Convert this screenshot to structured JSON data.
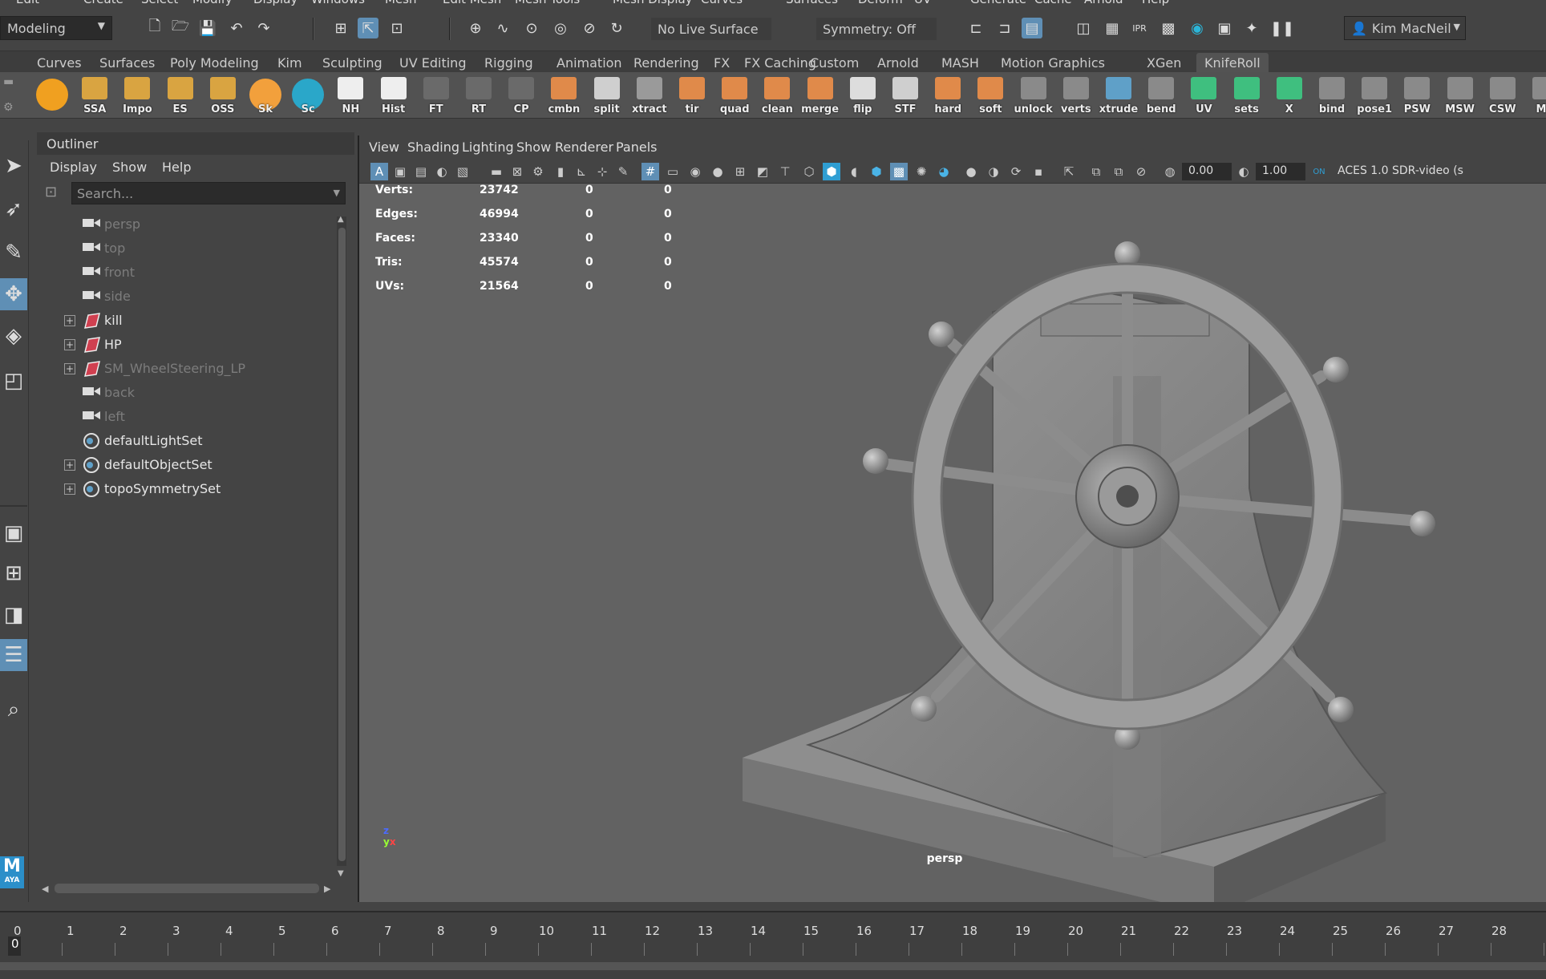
{
  "menubar": [
    "Edit",
    "Create",
    "Select",
    "Modify",
    "Display",
    "Windows",
    "Mesh",
    "Edit Mesh",
    "Mesh Tools",
    "Mesh Display",
    "Curves",
    "Surfaces",
    "Deform",
    "UV",
    "Generate",
    "Cache",
    "Arnold",
    "Help"
  ],
  "status": {
    "mode": "Modeling",
    "live_surface": "No Live Surface",
    "symmetry": "Symmetry: Off",
    "user": "Kim MacNeil"
  },
  "shelf_tabs": [
    "Curves",
    "Surfaces",
    "Poly Modeling",
    "Kim",
    "Sculpting",
    "UV Editing",
    "Rigging",
    "Animation",
    "Rendering",
    "FX",
    "FX Caching",
    "Custom",
    "Arnold",
    "MASH",
    "Motion Graphics",
    "XGen",
    "KnifeRoll"
  ],
  "shelf_active": "KnifeRoll",
  "shelf_buttons": [
    {
      "label": "",
      "color": "#f0a020"
    },
    {
      "label": "SSA",
      "color": "#d9a441"
    },
    {
      "label": "Impo",
      "color": "#d9a441"
    },
    {
      "label": "ES",
      "color": "#d9a441"
    },
    {
      "label": "OSS",
      "color": "#d9a441"
    },
    {
      "label": "Sk",
      "color": "#f2a03c"
    },
    {
      "label": "Sc",
      "color": "#2aa7c9"
    },
    {
      "label": "NH",
      "color": "#eeeeee"
    },
    {
      "label": "Hist",
      "color": "#eeeeee"
    },
    {
      "label": "FT",
      "color": "#6a6a6a"
    },
    {
      "label": "RT",
      "color": "#6a6a6a"
    },
    {
      "label": "CP",
      "color": "#6a6a6a"
    },
    {
      "label": "cmbn",
      "color": "#e08a4a"
    },
    {
      "label": "split",
      "color": "#cfcfcf"
    },
    {
      "label": "xtract",
      "color": "#9a9a9a"
    },
    {
      "label": "tir",
      "color": "#e08a4a"
    },
    {
      "label": "quad",
      "color": "#e08a4a"
    },
    {
      "label": "clean",
      "color": "#e08a4a"
    },
    {
      "label": "merge",
      "color": "#e08a4a"
    },
    {
      "label": "flip",
      "color": "#dddddd"
    },
    {
      "label": "STF",
      "color": "#cfcfcf"
    },
    {
      "label": "hard",
      "color": "#e08a4a"
    },
    {
      "label": "soft",
      "color": "#e08a4a"
    },
    {
      "label": "unlock",
      "color": "#8a8a8a"
    },
    {
      "label": "verts",
      "color": "#8a8a8a"
    },
    {
      "label": "xtrude",
      "color": "#5fa0c8"
    },
    {
      "label": "bend",
      "color": "#8a8a8a"
    },
    {
      "label": "UV",
      "color": "#3fbf7f"
    },
    {
      "label": "sets",
      "color": "#3fbf7f"
    },
    {
      "label": "X",
      "color": "#3fbf7f"
    },
    {
      "label": "bind",
      "color": "#8a8a8a"
    },
    {
      "label": "pose1",
      "color": "#8a8a8a"
    },
    {
      "label": "PSW",
      "color": "#8a8a8a"
    },
    {
      "label": "MSW",
      "color": "#8a8a8a"
    },
    {
      "label": "CSW",
      "color": "#8a8a8a"
    },
    {
      "label": "MA",
      "color": "#8a8a8a"
    }
  ],
  "outliner": {
    "title": "Outliner",
    "menu": [
      "Display",
      "Show",
      "Help"
    ],
    "search_placeholder": "Search...",
    "items": [
      {
        "name": "persp",
        "type": "camera",
        "expand": false,
        "style": "dim"
      },
      {
        "name": "top",
        "type": "camera",
        "expand": false,
        "style": "dim"
      },
      {
        "name": "front",
        "type": "camera",
        "expand": false,
        "style": "dim"
      },
      {
        "name": "side",
        "type": "camera",
        "expand": false,
        "style": "dim"
      },
      {
        "name": "kill",
        "type": "transform",
        "expand": true,
        "style": "bright"
      },
      {
        "name": "HP",
        "type": "transform",
        "expand": true,
        "style": "bright"
      },
      {
        "name": "SM_WheelSteering_LP",
        "type": "transform",
        "expand": true,
        "style": "dim"
      },
      {
        "name": "back",
        "type": "camera",
        "expand": false,
        "style": "dim"
      },
      {
        "name": "left",
        "type": "camera",
        "expand": false,
        "style": "dim"
      },
      {
        "name": "defaultLightSet",
        "type": "set",
        "expand": false,
        "style": "bright"
      },
      {
        "name": "defaultObjectSet",
        "type": "set",
        "expand": true,
        "style": "bright"
      },
      {
        "name": "topoSymmetrySet",
        "type": "set",
        "expand": true,
        "style": "bright"
      }
    ]
  },
  "viewport": {
    "menu": [
      "View",
      "Shading",
      "Lighting",
      "Show",
      "Renderer",
      "Panels"
    ],
    "exposure": "0.00",
    "gamma": "1.00",
    "colorspace": "ACES 1.0 SDR-video (s",
    "camera_label": "persp",
    "hud": [
      {
        "label": "Verts:",
        "a": "23742",
        "b": "0",
        "c": "0"
      },
      {
        "label": "Edges:",
        "a": "46994",
        "b": "0",
        "c": "0"
      },
      {
        "label": "Faces:",
        "a": "23340",
        "b": "0",
        "c": "0"
      },
      {
        "label": "Tris:",
        "a": "45574",
        "b": "0",
        "c": "0"
      },
      {
        "label": "UVs:",
        "a": "21564",
        "b": "0",
        "c": "0"
      }
    ]
  },
  "timeline": {
    "current_frame": "0",
    "frames": [
      "0",
      "1",
      "2",
      "3",
      "4",
      "5",
      "6",
      "7",
      "8",
      "9",
      "10",
      "11",
      "12",
      "13",
      "14",
      "15",
      "16",
      "17",
      "18",
      "19",
      "20",
      "21",
      "22",
      "23",
      "24",
      "25",
      "26",
      "27",
      "28"
    ]
  }
}
